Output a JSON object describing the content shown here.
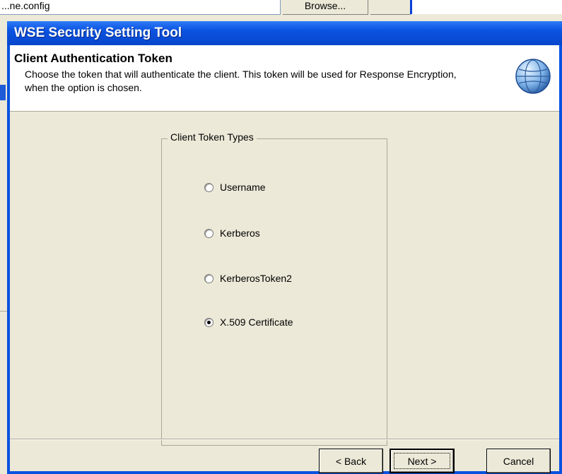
{
  "background": {
    "field_text": "...ne.config",
    "browse_label": "Browse..."
  },
  "dialog": {
    "title": "WSE Security Setting Tool",
    "header_title": "Client Authentication Token",
    "header_desc": "Choose the token that will authenticate the client. This token will be used for Response Encryption, when the option is chosen.",
    "group_label": "Client Token Types",
    "options": [
      {
        "label": "Username",
        "checked": false
      },
      {
        "label": "Kerberos",
        "checked": false
      },
      {
        "label": "KerberosToken2",
        "checked": false
      },
      {
        "label": "X.509 Certificate",
        "checked": true
      }
    ],
    "buttons": {
      "back": "< Back",
      "next": "Next >",
      "cancel": "Cancel"
    }
  },
  "icons": {
    "header_icon": "globe-icon",
    "radio_icon": "radio-button-icon"
  },
  "colors": {
    "titlebar": "#0a52e0",
    "dialog_bg": "#ece9d8",
    "header_bg": "#ffffff"
  }
}
